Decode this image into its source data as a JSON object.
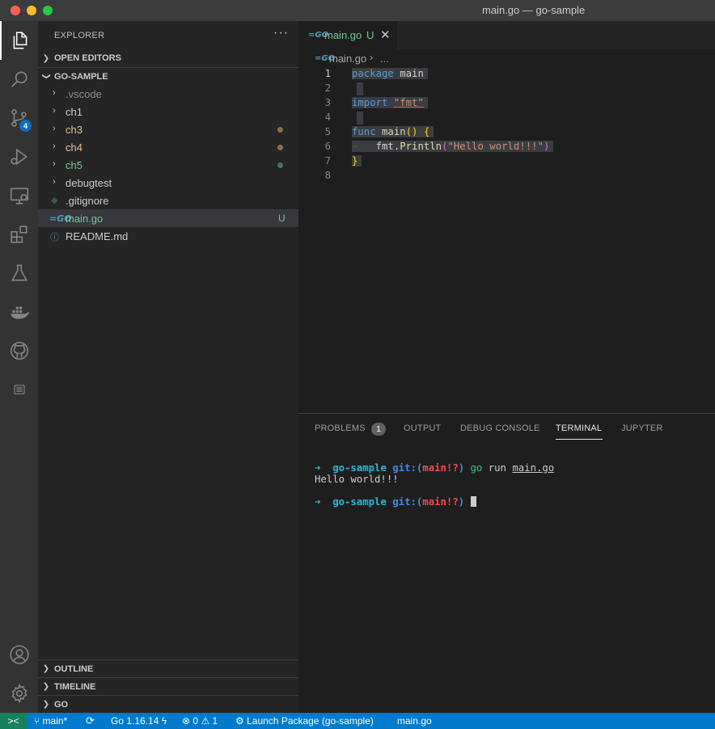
{
  "window": {
    "title": "main.go — go-sample"
  },
  "activity_bar": {
    "items": [
      {
        "name": "explorer-icon",
        "active": true
      },
      {
        "name": "search-icon"
      },
      {
        "name": "source-control-icon",
        "badge": "4"
      },
      {
        "name": "run-debug-icon"
      },
      {
        "name": "remote-explorer-icon"
      },
      {
        "name": "extensions-icon"
      },
      {
        "name": "testing-icon"
      },
      {
        "name": "docker-icon"
      },
      {
        "name": "github-icon"
      },
      {
        "name": "notebook-icon"
      }
    ],
    "bottom": [
      {
        "name": "account-icon"
      },
      {
        "name": "settings-gear-icon"
      }
    ]
  },
  "sidebar": {
    "title": "EXPLORER",
    "more": "···",
    "open_editors": "OPEN EDITORS",
    "root": "GO-SAMPLE",
    "files": [
      {
        "label": ".vscode",
        "type": "folder",
        "color": "#8c8c8c"
      },
      {
        "label": "ch1",
        "type": "folder",
        "color": "#cccccc"
      },
      {
        "label": "ch3",
        "type": "folder",
        "color": "#e2c08d",
        "dot": "#8a7248"
      },
      {
        "label": "ch4",
        "type": "folder",
        "color": "#e2c08d",
        "dot": "#8a7248"
      },
      {
        "label": "ch5",
        "type": "folder",
        "color": "#73c991",
        "dot": "#3c7a55"
      },
      {
        "label": "debugtest",
        "type": "folder",
        "color": "#cccccc"
      },
      {
        "label": ".gitignore",
        "type": "file",
        "color": "#cccccc"
      },
      {
        "label": "main.go",
        "type": "file",
        "color": "#73c991",
        "status": "U",
        "selected": true
      },
      {
        "label": "README.md",
        "type": "file",
        "color": "#cccccc"
      }
    ],
    "outline": "OUTLINE",
    "timeline": "TIMELINE",
    "go": "GO"
  },
  "editor": {
    "tab": {
      "label": "main.go",
      "status": "U",
      "close": "✕"
    },
    "breadcrumb": {
      "file": "main.go",
      "sep": "›",
      "more": "..."
    },
    "lines": [
      "1",
      "2",
      "3",
      "4",
      "5",
      "6",
      "7",
      "8"
    ],
    "code": {
      "l1_kw": "package",
      "l1_id": "main",
      "l3_kw": "import",
      "l3_str": "\"fmt\"",
      "l5_kw": "func",
      "l5_fn": "main",
      "l5_paren": "()",
      "l5_brace": "{",
      "l6_tab": "→",
      "l6_pkg": "fmt.",
      "l6_fn": "Println",
      "l6_open": "(",
      "l6_str": "\"Hello world!!!\"",
      "l6_close": ")",
      "l7_brace": "}"
    }
  },
  "panel": {
    "tabs": [
      "PROBLEMS",
      "OUTPUT",
      "DEBUG CONSOLE",
      "TERMINAL",
      "JUPYTER"
    ],
    "active": "TERMINAL",
    "problems_count": "1",
    "terminal": {
      "arrow": "➜",
      "dir": "go-sample",
      "git_open": "git:(",
      "branch": "main!?",
      "git_close": ")",
      "cmd": "go",
      "args": "run",
      "file": "main.go",
      "output": "Hello world!!!"
    }
  },
  "status_bar": {
    "remote": "><",
    "branch": "main*",
    "sync": "⟳",
    "go_version": "Go 1.16.14",
    "go_icon": "ϟ",
    "errors": "0",
    "warnings": "1",
    "launch": "Launch Package (go-sample)",
    "file": "main.go"
  }
}
